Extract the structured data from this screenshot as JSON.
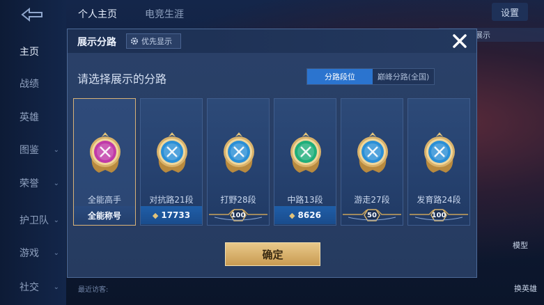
{
  "top_nav": {
    "tab_profile": "个人主页",
    "tab_esports": "电竞生涯"
  },
  "settings_label": "设置",
  "top_right_text": "更和数据展示",
  "sidebar": {
    "items": [
      {
        "label": "主页",
        "has_chevron": false
      },
      {
        "label": "战绩",
        "has_chevron": false
      },
      {
        "label": "英雄",
        "has_chevron": false
      },
      {
        "label": "图鉴",
        "has_chevron": true
      },
      {
        "label": "荣誉",
        "has_chevron": true
      },
      {
        "label": "护卫队",
        "has_chevron": true
      },
      {
        "label": "游戏",
        "has_chevron": true
      },
      {
        "label": "社交",
        "has_chevron": true
      }
    ]
  },
  "recent_visitors_label": "最近访客:",
  "model_label": "模型",
  "swap_hero_label": "换英雄",
  "modal": {
    "title": "展示分路",
    "priority_label": "优先显示",
    "subtitle": "请选择展示的分路",
    "segment": {
      "on": "分路段位",
      "off": "巅峰分路(全国)"
    },
    "confirm_label": "确定",
    "cards": [
      {
        "name": "全能高手",
        "stat": "全能称号",
        "stat_type": "label",
        "icon": "all-round-badge-icon",
        "selected": true,
        "color": "#c03aa8"
      },
      {
        "name": "对抗路21段",
        "stat": "17733",
        "stat_type": "points",
        "icon": "clash-lane-badge-icon",
        "selected": false,
        "color": "#2b8fd6"
      },
      {
        "name": "打野28段",
        "stat": "100",
        "stat_type": "stars",
        "icon": "jungle-badge-icon",
        "selected": false,
        "color": "#2b8fd6"
      },
      {
        "name": "中路13段",
        "stat": "8626",
        "stat_type": "points",
        "icon": "mid-lane-badge-icon",
        "selected": false,
        "color": "#1fae7a"
      },
      {
        "name": "游走27段",
        "stat": "50",
        "stat_type": "stars",
        "icon": "roam-badge-icon",
        "selected": false,
        "color": "#2b8fd6"
      },
      {
        "name": "发育路24段",
        "stat": "100",
        "stat_type": "stars",
        "icon": "farm-lane-badge-icon",
        "selected": false,
        "color": "#2b8fd6"
      }
    ]
  }
}
